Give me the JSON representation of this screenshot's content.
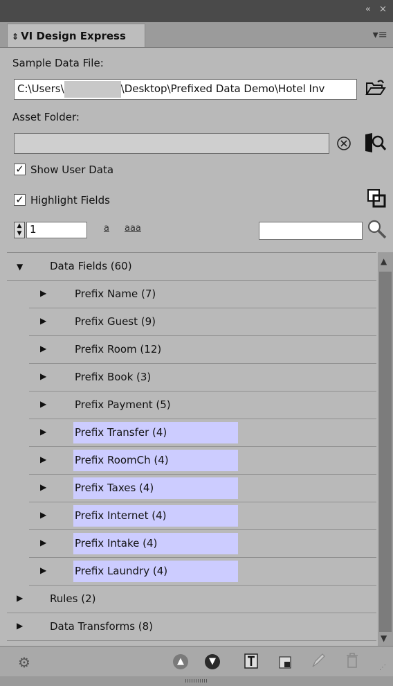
{
  "window": {
    "controls": "«  ×",
    "tab_label": "VI Design Express",
    "menu_icon": "panel-menu-icon"
  },
  "sample_data_file": {
    "label": "Sample Data File:",
    "path_prefix": "C:\\Users\\",
    "path_suffix": "\\Desktop\\Prefixed Data Demo\\Hotel Inv",
    "browse_icon": "open-folder-icon"
  },
  "asset_folder": {
    "label": "Asset Folder:",
    "value": "",
    "clear_icon": "clear-circle-x-icon",
    "browse_icon": "folder-search-icon"
  },
  "options": {
    "show_user_data": {
      "label": "Show User Data",
      "checked": true
    },
    "highlight_fields": {
      "label": "Highlight Fields",
      "checked": true
    }
  },
  "toolbar": {
    "record_number": "1",
    "case_lower_label": "a",
    "case_multi_label": "aaa",
    "search_value": ""
  },
  "tree": {
    "data_fields": {
      "label": "Data Fields (60)"
    },
    "children": [
      {
        "label": "Prefix Name (7)",
        "highlighted": false
      },
      {
        "label": "Prefix Guest (9)",
        "highlighted": false
      },
      {
        "label": "Prefix Room (12)",
        "highlighted": false
      },
      {
        "label": "Prefix Book (3)",
        "highlighted": false
      },
      {
        "label": "Prefix Payment (5)",
        "highlighted": false
      },
      {
        "label": "Prefix Transfer (4)",
        "highlighted": true
      },
      {
        "label": "Prefix RoomCh (4)",
        "highlighted": true
      },
      {
        "label": "Prefix Taxes (4)",
        "highlighted": true
      },
      {
        "label": "Prefix Internet (4)",
        "highlighted": true
      },
      {
        "label": "Prefix Intake (4)",
        "highlighted": true
      },
      {
        "label": "Prefix Laundry (4)",
        "highlighted": true
      }
    ],
    "rules": {
      "label": "Rules (2)"
    },
    "data_transforms": {
      "label": "Data Transforms (8)"
    }
  },
  "colors": {
    "highlight": "#ccccff",
    "panel_bg": "#b9b9b9"
  }
}
